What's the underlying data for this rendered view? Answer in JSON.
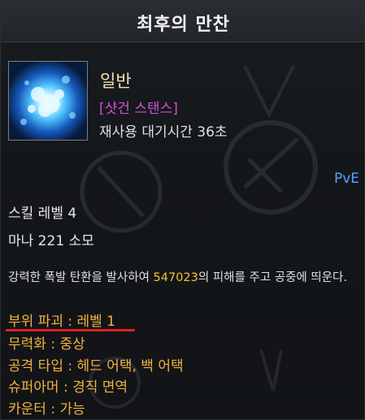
{
  "tooltip": {
    "title": "최후의 만찬",
    "grade": "일반",
    "stance": "[샷건 스탠스]",
    "cooldown": "재사용 대기시간 36초",
    "mode": "PvE",
    "skill_level": "스킬 레벨 4",
    "mana": "마나 221 소모",
    "description": {
      "before": "강력한 폭발 탄환을 발사하여 ",
      "damage": "547023",
      "after": "의 피해를 주고 공중에 띄운다."
    },
    "attributes": [
      "부위 파괴 : 레벨 1",
      "무력화 : 중상",
      "공격 타입 : 헤드 어택, 백 어택",
      "슈퍼아머 : 경직 면역",
      "카운터 : 가능"
    ],
    "highlighted_attribute": 0,
    "colors": {
      "grade": "#f3e3b0",
      "stance": "#d14fd8",
      "mode": "#5aa0ff",
      "damage": "#f5c431",
      "attribute": "#f0b341",
      "highlight_underline": "#e02020"
    },
    "icon": "explosion-skill-icon"
  }
}
